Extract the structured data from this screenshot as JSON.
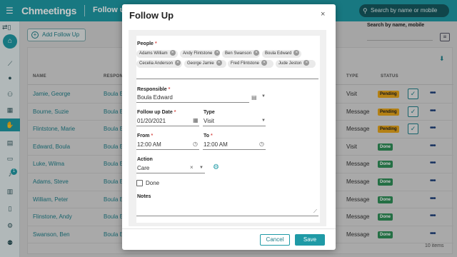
{
  "app": {
    "logo": "Chmeetings",
    "page_title": "Follow up",
    "search_placeholder": "Search by name or mobile"
  },
  "colors": {
    "brand": "#1f9aa6",
    "pending": "#e7a61b",
    "done": "#2f8f58"
  },
  "sidebar": {
    "active": "followup",
    "notification_count": "1",
    "icons": [
      "arrows-icon",
      "org-icon",
      "chart-icon",
      "person-icon",
      "people-icon",
      "calendar-icon",
      "handshake-icon",
      "planner-icon",
      "money-icon",
      "bell-icon",
      "bar-chart-icon",
      "mobile-icon",
      "settings-icon",
      "group-icon"
    ]
  },
  "toolbar": {
    "add_label": "Add Follow Up",
    "search_filter_label": "Search by name, mobile"
  },
  "table": {
    "columns": {
      "name": "NAME",
      "responsible": "RESPON",
      "type": "TYPE",
      "status": "STATUS"
    },
    "rows": [
      {
        "name": "Jamie, George",
        "responsible": "Boula E",
        "type": "Visit",
        "status": "Pending",
        "status_kind": "pending",
        "check": true
      },
      {
        "name": "Bourne, Suzie",
        "responsible": "Boula E",
        "type": "Message",
        "status": "Pending",
        "status_kind": "pending",
        "check": true
      },
      {
        "name": "Flintstone, Marie",
        "responsible": "Boula E",
        "type": "Message",
        "status": "Pending",
        "status_kind": "pending",
        "check": true
      },
      {
        "name": "Edward, Boula",
        "responsible": "Boula E",
        "type": "Visit",
        "status": "Done",
        "status_kind": "done",
        "check": false
      },
      {
        "name": "Luke, Wilma",
        "responsible": "Boula E",
        "type": "Message",
        "status": "Done",
        "status_kind": "done",
        "check": false
      },
      {
        "name": "Adams, Steve",
        "responsible": "Boula E",
        "type": "Message",
        "status": "Done",
        "status_kind": "done",
        "check": false
      },
      {
        "name": "William, Peter",
        "responsible": "Boula E",
        "type": "Message",
        "status": "Done",
        "status_kind": "done",
        "check": false
      },
      {
        "name": "Flinstone, Andy",
        "responsible": "Boula E",
        "type": "Message",
        "status": "Done",
        "status_kind": "done",
        "check": false
      },
      {
        "name": "Swanson, Ben",
        "responsible": "Boula E",
        "type": "Message",
        "status": "Done",
        "status_kind": "done",
        "check": false
      }
    ],
    "items_count": "10 items"
  },
  "modal": {
    "title": "Follow Up",
    "close": "×",
    "people_label": "People",
    "people": [
      "Adams William",
      "Andy Flintstone",
      "Ben Swanson",
      "Boula Edward",
      "Cecelia Anderson",
      "George Jamie",
      "Fred Flintstone",
      "Jude Jeston"
    ],
    "responsible_label": "Responsible",
    "responsible_value": "Boula  Edward",
    "followup_date_label": "Follow up Date",
    "followup_date_value": "01/20/2021",
    "type_label": "Type",
    "type_value": "Visit",
    "from_label": "From",
    "from_value": "12:00 AM",
    "to_label": "To",
    "to_value": "12:00 AM",
    "action_label": "Action",
    "action_value": "Care",
    "done_label": "Done",
    "done_checked": false,
    "notes_label": "Notes",
    "notes_value": "",
    "cancel_label": "Cancel",
    "save_label": "Save"
  }
}
